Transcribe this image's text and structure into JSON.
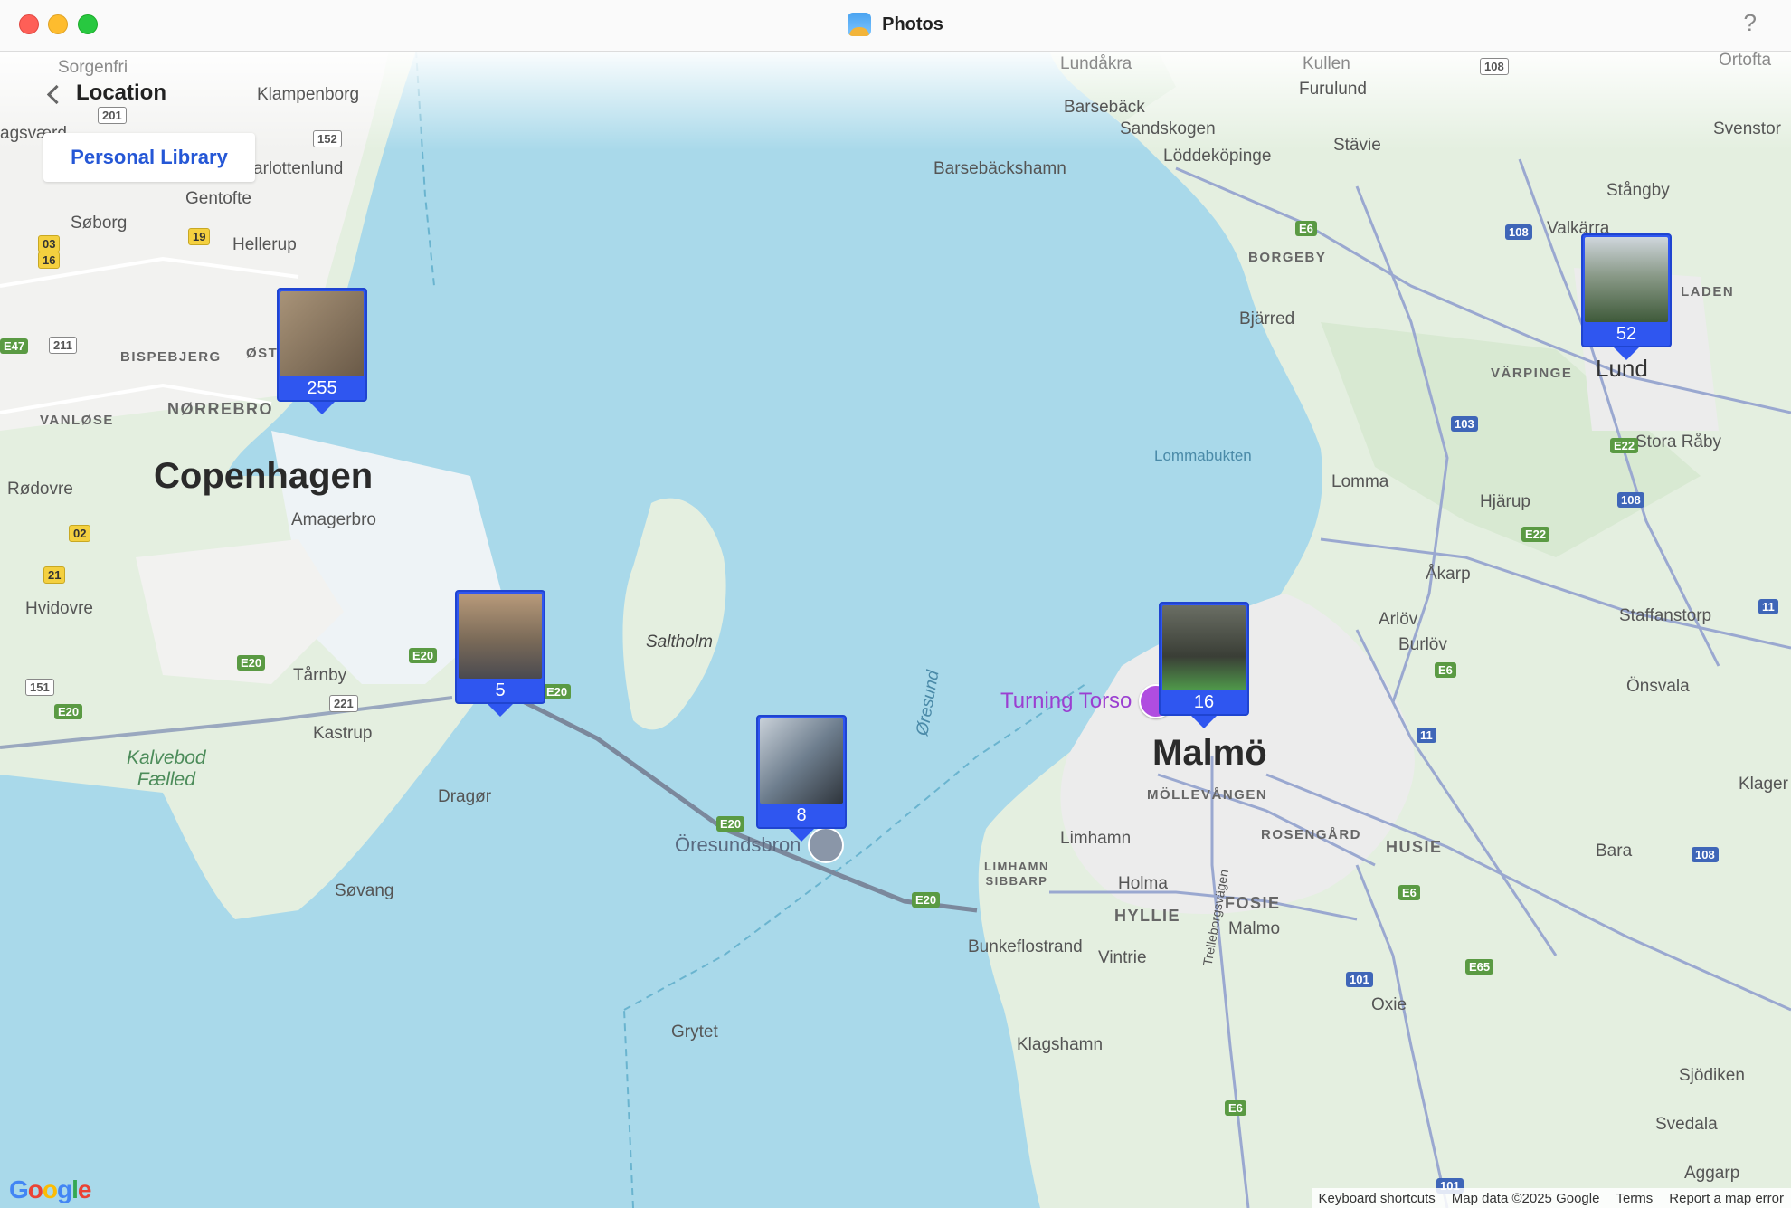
{
  "window": {
    "title": "Photos",
    "help_label": "?"
  },
  "nav": {
    "title": "Location",
    "library_button": "Personal Library"
  },
  "pins": [
    {
      "count": "255",
      "thumb_color": "#8c7a64"
    },
    {
      "count": "5",
      "thumb_color": "#7a6a58"
    },
    {
      "count": "8",
      "thumb_color": "#6e7e8e"
    },
    {
      "count": "16",
      "thumb_color": "#4a4e44"
    },
    {
      "count": "52",
      "thumb_color": "#5d7a58"
    }
  ],
  "labels": {
    "copenhagen": "Copenhagen",
    "malmo": "Malmö",
    "lund": "Lund",
    "sorgenfri": "Sorgenfri",
    "klampenborg": "Klampenborg",
    "gentofte": "Gentofte",
    "soborg": "Søborg",
    "hellerup": "Hellerup",
    "charlottenlund": "arlottenlund",
    "agsvaerd": "agsværd",
    "bispebjerg": "BISPEBJERG",
    "ost": "ØST",
    "norrebro": "NØRREBRO",
    "vanlose": "VANLØSE",
    "rodovre": "Rødovre",
    "amagerbro": "Amagerbro",
    "hvidovre": "Hvidovre",
    "tarnby": "Tårnby",
    "kastrup": "Kastrup",
    "kalvebod": "Kalvebod\nFælled",
    "dragor": "Dragør",
    "sovang": "Søvang",
    "saltholm": "Saltholm",
    "oresund": "Øresund",
    "oresundsbron": "Öresundsbron",
    "grytet": "Grytet",
    "turning_torso": "Turning Torso",
    "lundakra": "Lundåkra",
    "kullen": "Kullen",
    "furulund": "Furulund",
    "barseback": "Barsebäck",
    "sandskogen": "Sandskogen",
    "loddekopinge": "Löddeköpinge",
    "stavie": "Stävie",
    "barsebackshamn": "Barsebäckshamn",
    "borgeby": "BORGEBY",
    "bjarred": "Bjärred",
    "lommabukten": "Lommabukten",
    "lomma": "Lomma",
    "stangby": "Stångby",
    "valkarra": "Valkärra",
    "svenstorp": "Svenstor",
    "laden": "LADEN",
    "varpinge": "VÄRPINGE",
    "stora_raby": "Stora Råby",
    "hjarup": "Hjärup",
    "akarp": "Åkarp",
    "arlov": "Arlöv",
    "burlov": "Burlöv",
    "staffanstorp": "Staffanstorp",
    "onsvala": "Önsvala",
    "klagerup": "Klager",
    "bara": "Bara",
    "husie": "HUSIE",
    "mollevangen": "MÖLLEVÅNGEN",
    "rosengard": "ROSENGÅRD",
    "limhamn": "Limhamn",
    "limhamn_sibbarp": "LIMHAMN\nSIBBARP",
    "holma": "Holma",
    "hyllie": "HYLLIE",
    "fosie": "FOSIE",
    "malmo_small": "Malmo",
    "trelleborgsvagen": "Trelleborgsvägen",
    "bunkeflostrand": "Bunkeflostrand",
    "vintrie": "Vintrie",
    "oxie": "Oxie",
    "klagshamn": "Klagshamn",
    "sjodiken": "Sjödiken",
    "svedala": "Svedala",
    "aggarp": "Aggarp",
    "ortofta": "Ortofta"
  },
  "shields": [
    "201",
    "152",
    "19",
    "03",
    "16",
    "211",
    "E47",
    "02",
    "21",
    "E20",
    "151",
    "221",
    "E20",
    "E20",
    "E20",
    "E20",
    "E20",
    "E6",
    "108",
    "103",
    "E22",
    "108",
    "E22",
    "E6",
    "11",
    "E6",
    "101",
    "E65",
    "108",
    "101",
    "11",
    "E6",
    "108"
  ],
  "footer": {
    "keyboard": "Keyboard shortcuts",
    "map_data": "Map data ©2025 Google",
    "terms": "Terms",
    "report": "Report a map error"
  },
  "google": [
    "G",
    "o",
    "o",
    "g",
    "l",
    "e"
  ]
}
